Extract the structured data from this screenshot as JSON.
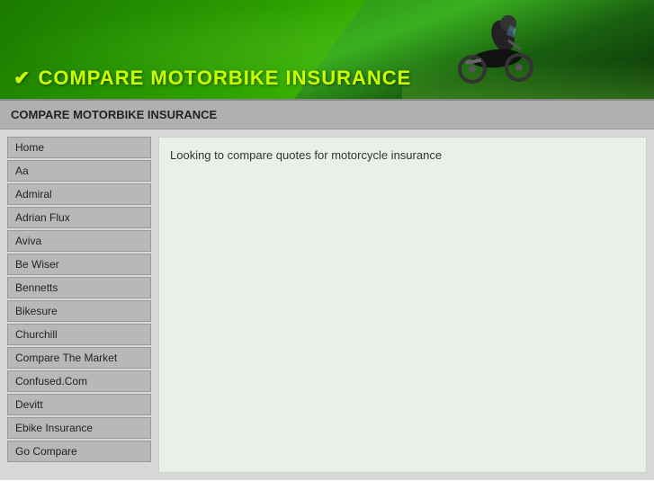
{
  "header": {
    "title": "COMPARE MOTORBIKE INSURANCE",
    "title_icon": "✔"
  },
  "page_title_bar": {
    "label": "COMPARE MOTORBIKE INSURANCE"
  },
  "sidebar": {
    "items": [
      {
        "label": "Home"
      },
      {
        "label": "Aa"
      },
      {
        "label": "Admiral"
      },
      {
        "label": "Adrian Flux"
      },
      {
        "label": "Aviva"
      },
      {
        "label": "Be Wiser"
      },
      {
        "label": "Bennetts"
      },
      {
        "label": "Bikesure"
      },
      {
        "label": "Churchill"
      },
      {
        "label": "Compare The Market"
      },
      {
        "label": "Confused.Com"
      },
      {
        "label": "Devitt"
      },
      {
        "label": "Ebike Insurance"
      },
      {
        "label": "Go Compare"
      }
    ]
  },
  "content": {
    "intro": "Looking to compare quotes for motorcycle insurance"
  }
}
